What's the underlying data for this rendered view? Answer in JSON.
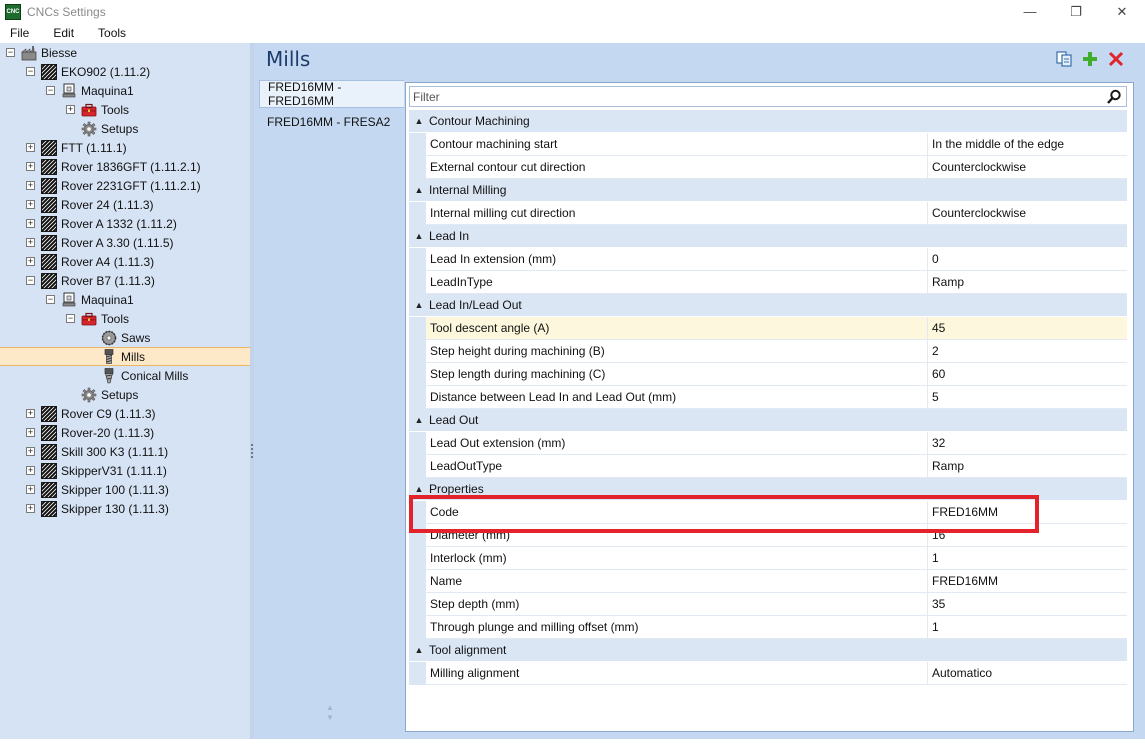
{
  "window": {
    "app_icon_text": "CNC",
    "title": "CNCs Settings",
    "controls": {
      "minimize": "—",
      "restore": "❐",
      "close": "✕"
    }
  },
  "menu": [
    "File",
    "Edit",
    "Tools"
  ],
  "tree": [
    {
      "label": "Biesse",
      "indent": 0,
      "expander": "-",
      "icon": "factory-icon"
    },
    {
      "label": "EKO902 (1.11.2)",
      "indent": 1,
      "expander": "-",
      "icon": "machine-icon"
    },
    {
      "label": "Maquina1",
      "indent": 2,
      "expander": "-",
      "icon": "machine-config-icon"
    },
    {
      "label": "Tools",
      "indent": 3,
      "expander": "+",
      "icon": "toolbox-icon"
    },
    {
      "label": "Setups",
      "indent": 3,
      "expander": "",
      "icon": "gear-icon"
    },
    {
      "label": "FTT (1.11.1)",
      "indent": 1,
      "expander": "+",
      "icon": "machine-icon"
    },
    {
      "label": "Rover 1836GFT (1.11.2.1)",
      "indent": 1,
      "expander": "+",
      "icon": "machine-icon"
    },
    {
      "label": "Rover 2231GFT (1.11.2.1)",
      "indent": 1,
      "expander": "+",
      "icon": "machine-icon"
    },
    {
      "label": "Rover 24 (1.11.3)",
      "indent": 1,
      "expander": "+",
      "icon": "machine-icon"
    },
    {
      "label": "Rover A 1332 (1.11.2)",
      "indent": 1,
      "expander": "+",
      "icon": "machine-icon"
    },
    {
      "label": "Rover A 3.30 (1.11.5)",
      "indent": 1,
      "expander": "+",
      "icon": "machine-icon"
    },
    {
      "label": "Rover A4 (1.11.3)",
      "indent": 1,
      "expander": "+",
      "icon": "machine-icon"
    },
    {
      "label": "Rover B7 (1.11.3)",
      "indent": 1,
      "expander": "-",
      "icon": "machine-icon"
    },
    {
      "label": "Maquina1",
      "indent": 2,
      "expander": "-",
      "icon": "machine-config-icon"
    },
    {
      "label": "Tools",
      "indent": 3,
      "expander": "-",
      "icon": "toolbox-icon"
    },
    {
      "label": "Saws",
      "indent": 4,
      "expander": "",
      "icon": "saw-icon"
    },
    {
      "label": "Mills",
      "indent": 4,
      "expander": "",
      "icon": "mill-icon",
      "selected": true
    },
    {
      "label": "Conical Mills",
      "indent": 4,
      "expander": "",
      "icon": "conical-mill-icon"
    },
    {
      "label": "Setups",
      "indent": 3,
      "expander": "",
      "icon": "gear-icon"
    },
    {
      "label": "Rover C9 (1.11.3)",
      "indent": 1,
      "expander": "+",
      "icon": "machine-icon"
    },
    {
      "label": "Rover-20 (1.11.3)",
      "indent": 1,
      "expander": "+",
      "icon": "machine-icon"
    },
    {
      "label": "Skill 300 K3 (1.11.1)",
      "indent": 1,
      "expander": "+",
      "icon": "machine-icon"
    },
    {
      "label": "SkipperV31 (1.11.1)",
      "indent": 1,
      "expander": "+",
      "icon": "machine-icon"
    },
    {
      "label": "Skipper 100 (1.11.3)",
      "indent": 1,
      "expander": "+",
      "icon": "machine-icon"
    },
    {
      "label": "Skipper 130 (1.11.3)",
      "indent": 1,
      "expander": "+",
      "icon": "machine-icon"
    }
  ],
  "panel": {
    "title": "Mills",
    "toolbar": [
      "copy-icon",
      "add-icon",
      "delete-icon"
    ]
  },
  "items": [
    {
      "label": "FRED16MM - FRED16MM",
      "selected": true
    },
    {
      "label": "FRED16MM - FRESA2",
      "selected": false
    }
  ],
  "filter": {
    "placeholder": "Filter",
    "value": ""
  },
  "grid": [
    {
      "category": "Contour Machining",
      "rows": [
        {
          "name": "Contour machining start",
          "value": "In the middle of the edge"
        },
        {
          "name": "External contour cut direction",
          "value": "Counterclockwise"
        }
      ]
    },
    {
      "category": "Internal Milling",
      "rows": [
        {
          "name": "Internal milling cut direction",
          "value": "Counterclockwise"
        }
      ]
    },
    {
      "category": "Lead In",
      "rows": [
        {
          "name": "Lead In extension (mm)",
          "value": "0"
        },
        {
          "name": "LeadInType",
          "value": "Ramp"
        }
      ]
    },
    {
      "category": "Lead In/Lead Out",
      "rows": [
        {
          "name": "Tool descent angle (A)",
          "value": "45",
          "highlight": true
        },
        {
          "name": "Step height during machining (B)",
          "value": "2"
        },
        {
          "name": "Step length during machining (C)",
          "value": "60"
        },
        {
          "name": "Distance between Lead In and Lead Out (mm)",
          "value": "5"
        }
      ]
    },
    {
      "category": "Lead Out",
      "rows": [
        {
          "name": "Lead Out extension (mm)",
          "value": "32"
        },
        {
          "name": "LeadOutType",
          "value": "Ramp"
        }
      ]
    },
    {
      "category": "Properties",
      "rows": [
        {
          "name": "Code",
          "value": "FRED16MM"
        },
        {
          "name": "Diameter (mm)",
          "value": "16"
        },
        {
          "name": "Interlock (mm)",
          "value": "1"
        },
        {
          "name": "Name",
          "value": "FRED16MM"
        },
        {
          "name": "Step depth (mm)",
          "value": "35"
        },
        {
          "name": "Through plunge and milling offset (mm)",
          "value": "1"
        }
      ]
    },
    {
      "category": "Tool alignment",
      "rows": [
        {
          "name": "Milling alignment",
          "value": "Automatico"
        }
      ]
    }
  ],
  "colors": {
    "annotation": "#e2232b",
    "panel_bg": "#c5d8f1",
    "tree_bg": "#d6e3f4",
    "title_text": "#1d3c6b"
  }
}
